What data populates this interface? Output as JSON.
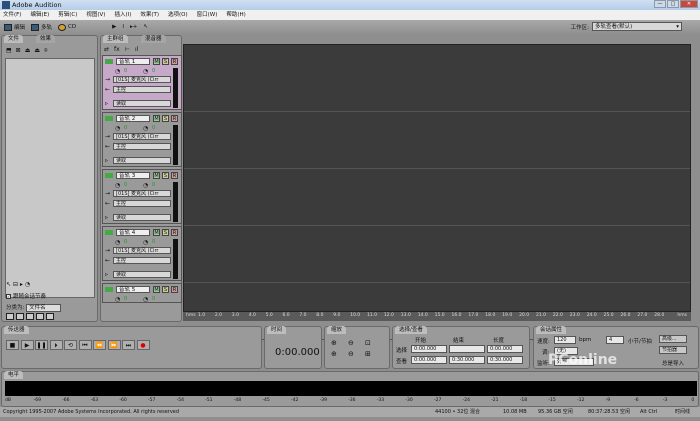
{
  "window": {
    "title": "Adobe Audition",
    "controls": [
      "—",
      "□",
      "✕"
    ]
  },
  "menu": [
    "文件(F)",
    "编辑(E)",
    "剪辑(C)",
    "视图(V)",
    "插入(I)",
    "效果(T)",
    "选项(O)",
    "窗口(W)",
    "帮助(H)"
  ],
  "toolbar": {
    "edit": "编辑",
    "multitrack": "多轨",
    "cd": "CD"
  },
  "workspace": {
    "label": "工作区:",
    "value": "多轨查看(默认)"
  },
  "left_panel": {
    "tabs": [
      "文件",
      "效果"
    ],
    "follow_label": "跟随会话节奏",
    "sort_label": "分类为:",
    "sort_value": "文件名"
  },
  "center_tabs": [
    "主群组",
    "混音器"
  ],
  "tracks": [
    {
      "name": "音轨 1",
      "input": "[01S] 麦克风 (Cirr",
      "output": "主控",
      "mode": "读取",
      "volume": "0",
      "pan": "0",
      "selected": true
    },
    {
      "name": "音轨 2",
      "input": "[01S] 麦克风 (Cirr",
      "output": "主控",
      "mode": "读取",
      "volume": "0",
      "pan": "0",
      "selected": false
    },
    {
      "name": "音轨 3",
      "input": "[01S] 麦克风 (Cirr",
      "output": "主控",
      "mode": "读取",
      "volume": "0",
      "pan": "0",
      "selected": false
    },
    {
      "name": "音轨 4",
      "input": "[01S] 麦克风 (Cirr",
      "output": "主控",
      "mode": "读取",
      "volume": "0",
      "pan": "0",
      "selected": false
    },
    {
      "name": "音轨 5",
      "input": "",
      "output": "",
      "mode": "",
      "volume": "0",
      "pan": "0",
      "selected": false
    }
  ],
  "track_buttons": [
    "M",
    "S",
    "R"
  ],
  "ruler": {
    "start": "hms",
    "end": "hms",
    "ticks": [
      "1.0",
      "2.0",
      "3.0",
      "4.0",
      "5.0",
      "6.0",
      "7.0",
      "8.0",
      "9.0",
      "10.0",
      "11.0",
      "12.0",
      "13.0",
      "14.0",
      "15.0",
      "16.0",
      "17.0",
      "18.0",
      "19.0",
      "20.0",
      "21.0",
      "22.0",
      "23.0",
      "24.0",
      "25.0",
      "26.0",
      "27.0",
      "28.0"
    ]
  },
  "transport": {
    "title": "传送器",
    "buttons": [
      "■",
      "▶",
      "❚❚",
      "⏵",
      "⟲",
      "⏮",
      "⏪",
      "⏩",
      "⏭",
      "●"
    ]
  },
  "time": {
    "title": "时间",
    "value": "0:00.000"
  },
  "zoom": {
    "title": "缩放"
  },
  "selection": {
    "title": "选择/查看",
    "headers": [
      "开始",
      "结束",
      "长度"
    ],
    "rows": [
      {
        "label": "选择",
        "start": "0:00.000",
        "end": "",
        "length": "0:00.000"
      },
      {
        "label": "查看",
        "start": "0:00.000",
        "end": "0:30.000",
        "length": "0:30.000"
      }
    ]
  },
  "session": {
    "title": "会话属性",
    "tempo_label": "速度:",
    "tempo": "120",
    "bpm": "bpm",
    "beats": "4",
    "beats_label": "小节/节拍",
    "advanced": "高级...",
    "metronome": "节拍器",
    "key_label": "调:",
    "key": "(无)",
    "monitor_label": "监听:",
    "monitor": "外部",
    "always_import": "总是导入"
  },
  "levels": {
    "title": "电平",
    "ticks": [
      "dB",
      "-69",
      "-66",
      "-63",
      "-60",
      "-57",
      "-54",
      "-51",
      "-48",
      "-45",
      "-42",
      "-39",
      "-36",
      "-33",
      "-30",
      "-27",
      "-24",
      "-21",
      "-18",
      "-15",
      "-12",
      "-9",
      "-6",
      "-3",
      "0"
    ]
  },
  "status": {
    "copyright": "Copyright 1995-2007 Adobe Systems Incorporated. All rights reserved",
    "format": "44100 • 32位 混合",
    "size": "10.08 MB",
    "disk": "95.36 GB 空闲",
    "time_free": "80:37:28.53 空闲",
    "keys": "Alt Ctrl",
    "label": "时间线"
  },
  "watermark": "PConline 太平洋电脑网"
}
